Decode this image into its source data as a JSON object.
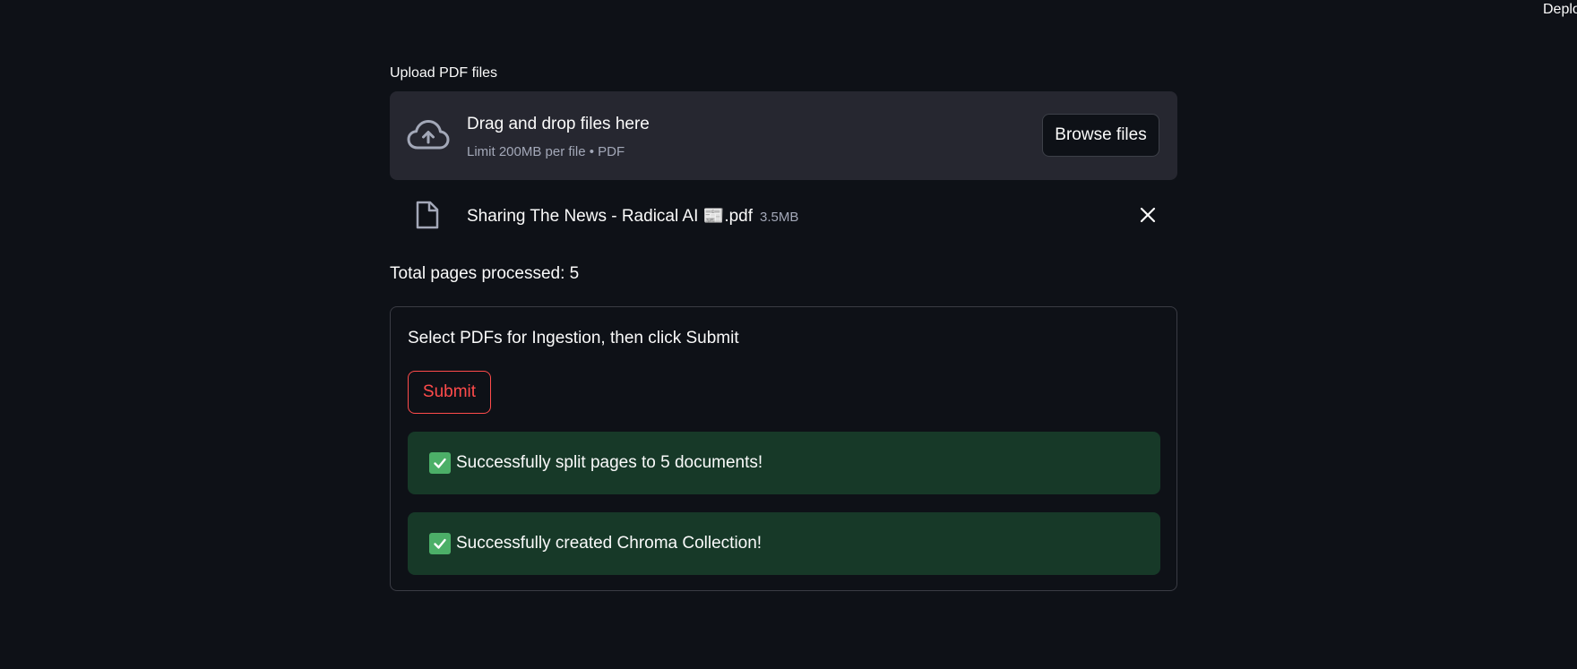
{
  "header": {
    "deploy_label": "Deplo"
  },
  "uploader": {
    "label": "Upload PDF files",
    "dropzone_title": "Drag and drop files here",
    "dropzone_subtitle": "Limit 200MB per file • PDF",
    "browse_label": "Browse files",
    "file": {
      "name": "Sharing The News - Radical AI 📰.pdf",
      "size": "3.5MB"
    }
  },
  "status": {
    "pages_processed": "Total pages processed: 5"
  },
  "form": {
    "title": "Select PDFs for Ingestion, then click Submit",
    "submit_label": "Submit",
    "alerts": [
      {
        "text": "Successfully split pages to 5 documents!"
      },
      {
        "text": "Successfully created Chroma Collection!"
      }
    ]
  },
  "colors": {
    "background": "#0e1117",
    "dropzone": "#262730",
    "accent": "#ff4b4b",
    "success_bg": "#173928",
    "check": "#4caf68"
  }
}
